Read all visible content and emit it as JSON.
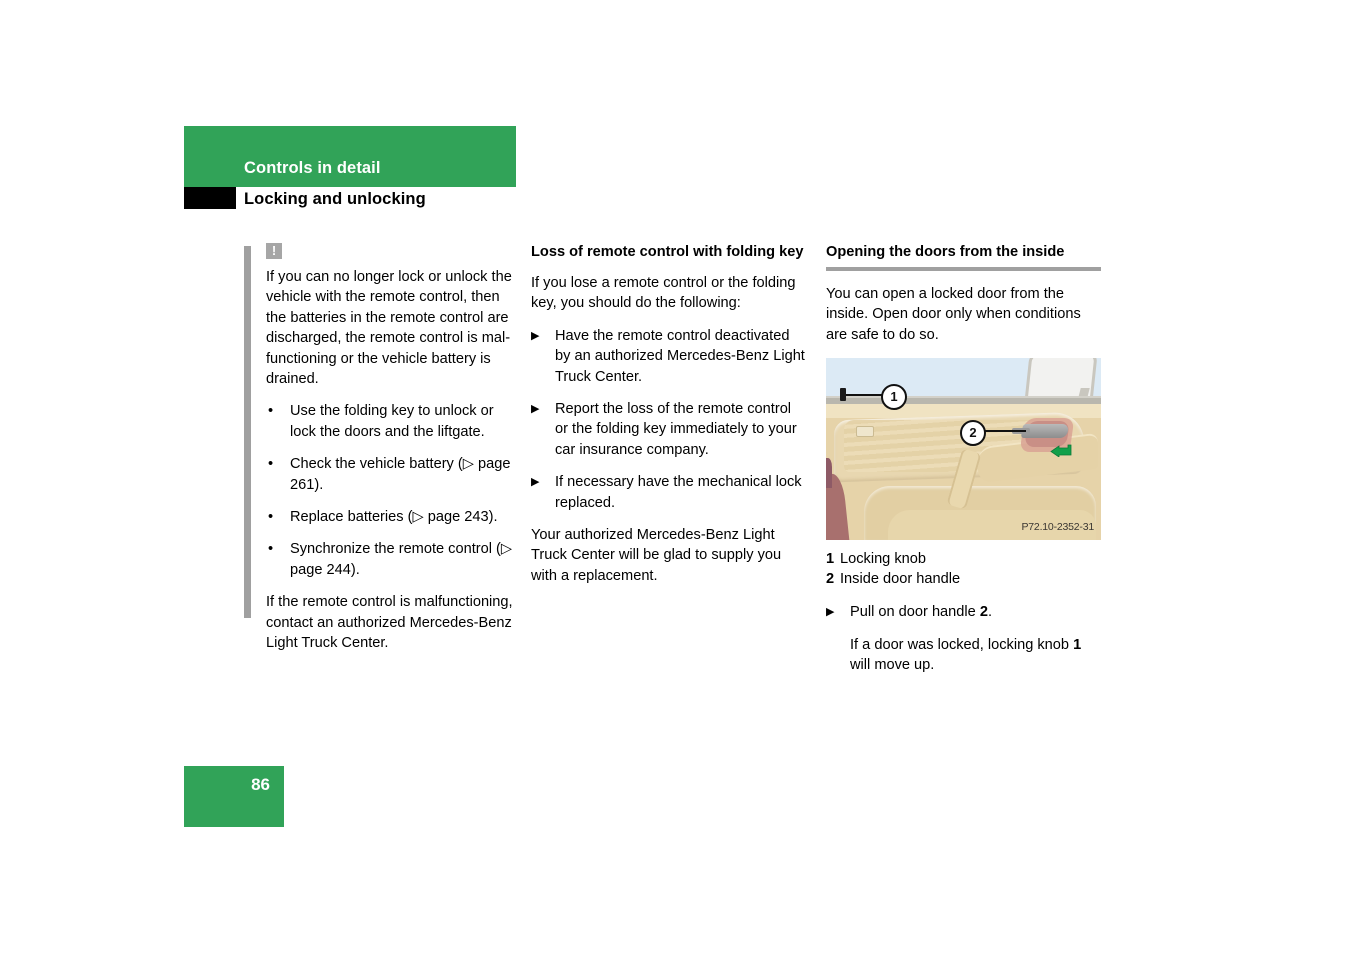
{
  "header": {
    "chapter": "Controls in detail",
    "section": "Locking and unlocking"
  },
  "colors": {
    "brand_green": "#31a358",
    "warning_gray": "#a0a0a0",
    "rule_gray": "#a0a0a0"
  },
  "column1": {
    "warning_icon": "warning-exclamation-icon",
    "warning_icon_glyph": "!",
    "intro": "If you can no longer lock or unlock the vehicle with the remote control, then the batteries in the remote control are discharged, the remote control is mal-functioning or the vehicle battery is drained.",
    "bullet_marker": "•",
    "bullets": [
      "Use the folding key to unlock or lock the doors and the liftgate.",
      "Check the vehicle battery (▷ page 261).",
      "Replace batteries (▷ page 243).",
      "Synchronize the remote control (▷ page 244)."
    ],
    "closing": "If the remote control is malfunctioning, contact an authorized Mercedes-Benz Light Truck Center."
  },
  "column2": {
    "heading": "Loss of remote control with folding key",
    "intro": "If you lose a remote control or the folding key, you should do the following:",
    "step_marker": "▶",
    "steps": [
      "Have the remote control deactivated by an authorized Mercedes-Benz Light Truck Center.",
      "Report the loss of the remote control or the folding key immediately to your car insurance company.",
      "If necessary have the mechanical lock replaced."
    ],
    "closing": "Your authorized Mercedes-Benz Light Truck Center will be glad to supply you with a replacement."
  },
  "column3": {
    "heading": "Opening the doors from the inside",
    "intro": "You can open a locked door from the inside. Open door only when conditions are safe to do so.",
    "illustration": {
      "name": "car-door-inside-illustration",
      "code": "P72.10-2352-31",
      "callouts": [
        {
          "num": "1",
          "target": "locking-knob"
        },
        {
          "num": "2",
          "target": "inside-door-handle"
        }
      ]
    },
    "legend": [
      {
        "num": "1",
        "label": "Locking knob"
      },
      {
        "num": "2",
        "label": "Inside door handle"
      }
    ],
    "step_marker": "▶",
    "step_prefix": "Pull on door handle ",
    "step_bold": "2",
    "step_suffix": ".",
    "note_prefix": "If a door was locked, locking knob ",
    "note_bold": "1",
    "note_suffix": " will move up."
  },
  "footer": {
    "page_number": "86"
  }
}
